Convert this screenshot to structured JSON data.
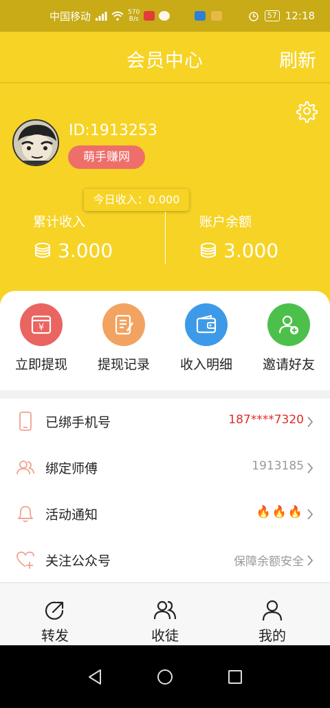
{
  "status_bar": {
    "carrier": "中国移动",
    "speed_value": "570",
    "speed_unit": "B/s",
    "battery": "57",
    "time": "12:18"
  },
  "header": {
    "title": "会员中心",
    "refresh_label": "刷新"
  },
  "profile": {
    "user_id": "ID:1913253",
    "badge": "萌手赚网",
    "today_income": "今日收入：0.000",
    "total_income_label": "累计收入",
    "total_income_value": "3.000",
    "balance_label": "账户余额",
    "balance_value": "3.000"
  },
  "actions": [
    {
      "label": "立即提现",
      "icon": "withdraw-icon",
      "color": "#ea6461"
    },
    {
      "label": "提现记录",
      "icon": "record-icon",
      "color": "#f3a361"
    },
    {
      "label": "收入明细",
      "icon": "wallet-icon",
      "color": "#3d9ae8"
    },
    {
      "label": "邀请好友",
      "icon": "invite-icon",
      "color": "#4dc04b"
    }
  ],
  "list": [
    {
      "label": "已绑手机号",
      "value": "187****7320",
      "icon": "phone-icon"
    },
    {
      "label": "绑定师傅",
      "value": "1913185",
      "icon": "users-icon"
    },
    {
      "label": "活动通知",
      "value": "🔥🔥🔥",
      "icon": "bell-icon"
    },
    {
      "label": "关注公众号",
      "value": "保障余额安全",
      "icon": "heart-plus-icon"
    }
  ],
  "tabs": [
    {
      "label": "转发",
      "icon": "share-icon"
    },
    {
      "label": "收徒",
      "icon": "users-icon"
    },
    {
      "label": "我的",
      "icon": "person-icon"
    }
  ],
  "colors": {
    "brand_yellow": "#f6d325",
    "status_bar": "#c8ab16",
    "badge_red": "#ee6e6a",
    "phone_red": "#e02b2b"
  }
}
